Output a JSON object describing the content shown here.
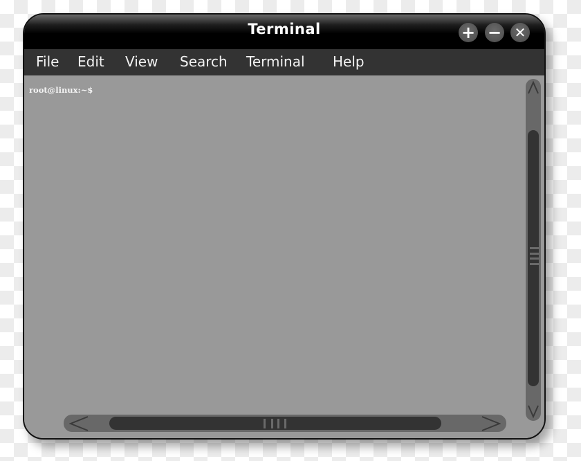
{
  "window": {
    "title": "Terminal",
    "controls": [
      {
        "name": "maximize",
        "glyph": "+"
      },
      {
        "name": "minimize",
        "glyph": "−"
      },
      {
        "name": "close",
        "glyph": "✕"
      }
    ]
  },
  "menubar": {
    "items": [
      "File",
      "Edit",
      "View",
      "Search",
      "Terminal",
      "Help"
    ]
  },
  "terminal": {
    "prompt": "root@linux:~$"
  },
  "scrollbars": {
    "vertical": {
      "up_glyph": "^",
      "down_glyph": "v"
    },
    "horizontal": {
      "left_glyph": "<",
      "right_glyph": ">"
    }
  },
  "colors": {
    "titlebar": "#000000",
    "menubar": "#333333",
    "content_bg": "#999999",
    "text": "#ffffff"
  }
}
